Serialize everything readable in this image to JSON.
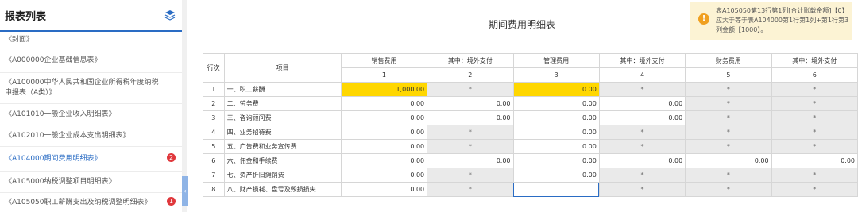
{
  "sidebar": {
    "title": "报表列表",
    "items": [
      {
        "label": "《封面》",
        "badge": "",
        "active": false
      },
      {
        "label": "《A000000企业基础信息表》",
        "badge": "",
        "active": false
      },
      {
        "label": "《A100000中华人民共和国企业所得税年度纳税申报表（A类）》",
        "badge": "",
        "active": false
      },
      {
        "label": "《A101010一般企业收入明细表》",
        "badge": "",
        "active": false
      },
      {
        "label": "《A102010一般企业成本支出明细表》",
        "badge": "",
        "active": false
      },
      {
        "label": "《A104000期间费用明细表》",
        "badge": "2",
        "active": true
      },
      {
        "label": "《A105000纳税调整项目明细表》",
        "badge": "",
        "active": false
      },
      {
        "label": "《A105050职工薪酬支出及纳税调整明细表》",
        "badge": "1",
        "active": false
      }
    ]
  },
  "main": {
    "title": "期间费用明细表",
    "warning": "表A105050第13行第1列[合计账载金额]【0】应大于等于表A104000第1行第1列+第1行第3列金额【1000】。",
    "table": {
      "headers": [
        "行次",
        "项目",
        "销售费用",
        "其中：境外支付",
        "管理费用",
        "其中：境外支付",
        "财务费用",
        "其中：境外支付"
      ],
      "col_numbers": [
        "1",
        "2",
        "3",
        "4",
        "5",
        "6"
      ],
      "rows": [
        {
          "no": "1",
          "item": "一、职工薪酬",
          "cells": [
            "1,000.00",
            "*",
            "0.00",
            "*",
            "*",
            "*"
          ]
        },
        {
          "no": "2",
          "item": "二、劳务费",
          "cells": [
            "0.00",
            "0.00",
            "0.00",
            "0.00",
            "*",
            "*"
          ]
        },
        {
          "no": "3",
          "item": "三、咨询顾问费",
          "cells": [
            "0.00",
            "0.00",
            "0.00",
            "0.00",
            "*",
            "*"
          ]
        },
        {
          "no": "4",
          "item": "四、业务招待费",
          "cells": [
            "0.00",
            "*",
            "0.00",
            "*",
            "*",
            "*"
          ]
        },
        {
          "no": "5",
          "item": "五、广告费和业务宣传费",
          "cells": [
            "0.00",
            "*",
            "0.00",
            "*",
            "*",
            "*"
          ]
        },
        {
          "no": "6",
          "item": "六、佣金和手续费",
          "cells": [
            "0.00",
            "0.00",
            "0.00",
            "0.00",
            "0.00",
            "0.00"
          ]
        },
        {
          "no": "7",
          "item": "七、资产折旧摊销费",
          "cells": [
            "0.00",
            "*",
            "0.00",
            "*",
            "*",
            "*"
          ]
        },
        {
          "no": "8",
          "item": "八、财产损耗、盘亏及毁损损失",
          "cells": [
            "0.00",
            "*",
            "",
            "*",
            "*",
            "*"
          ]
        }
      ]
    }
  },
  "colors": {
    "accent": "#2a6cc4",
    "highlight": "#ffd700",
    "badge": "#e0383c",
    "warning_bg": "#fcf3d4"
  }
}
